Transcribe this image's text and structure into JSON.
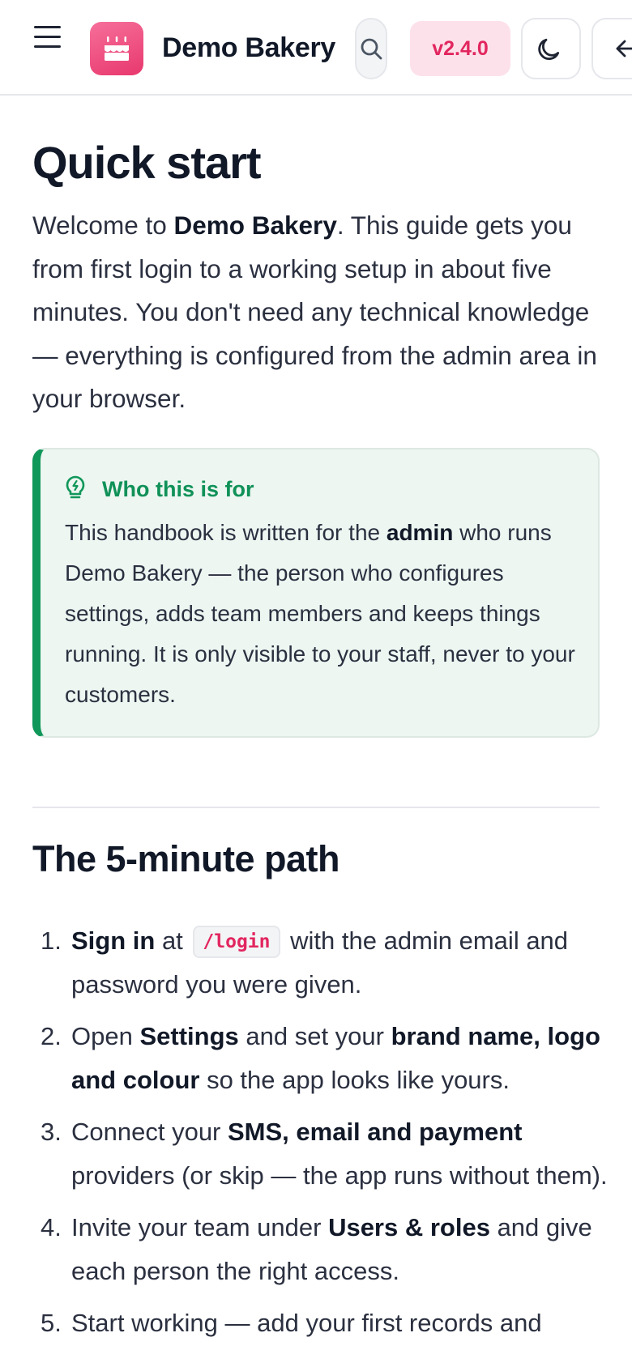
{
  "header": {
    "brand": "Demo Bakery",
    "version": "v2.4.0",
    "icons": [
      "menu-icon",
      "cake-icon",
      "search-icon",
      "moon-icon",
      "arrow-left-icon"
    ],
    "colors": {
      "accent": "#e2265f",
      "accent_bg": "#fde1ea",
      "success": "#10975a"
    }
  },
  "page": {
    "title": "Quick start",
    "intro": {
      "t1": "Welcome to ",
      "b1": "Demo Bakery",
      "t2": ". This guide gets you from first login to a working setup in about five minutes. You don't need any technical knowledge — everything is configured from the admin area in your browser."
    },
    "callout": {
      "title": "Who this is for",
      "icon": "lightbulb-icon",
      "t1": "This handbook is written for the ",
      "b1": "admin",
      "t2": " who runs Demo Bakery — the person who configures settings, adds team members and keeps things running. It is only visible to your staff, never to your customers."
    },
    "section_title": "The 5-minute path",
    "steps": [
      {
        "num": "1.",
        "b1": "Sign in",
        "t1": " at ",
        "code": "/login",
        "t2": " with the admin email and password you were given."
      },
      {
        "num": "2.",
        "t0": "Open ",
        "b1": "Settings",
        "t1": " and set your ",
        "b2": "brand name, logo and colour",
        "t2": " so the app looks like yours."
      },
      {
        "num": "3.",
        "t0": "Connect your ",
        "b1": "SMS, email and payment",
        "t1": " providers (or skip — the app runs without them)."
      },
      {
        "num": "4.",
        "t0": "Invite your team under ",
        "b1": "Users & roles",
        "t1": " and give each person the right access."
      },
      {
        "num": "5.",
        "t0": "Start working — add your first records and"
      }
    ]
  }
}
